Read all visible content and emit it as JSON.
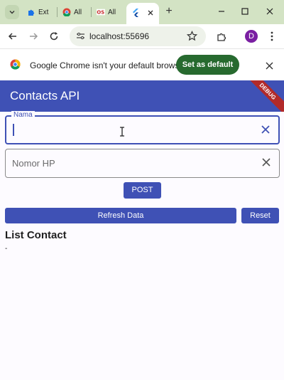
{
  "browser": {
    "tabs": [
      {
        "label": "Ext",
        "icon": "puzzle-icon"
      },
      {
        "label": "All",
        "icon": "chrome-icon"
      },
      {
        "label": "All",
        "icon": "ots-icon"
      },
      {
        "label": "",
        "icon": "flutter-icon"
      }
    ],
    "new_tab_label": "+",
    "url": "localhost:55696",
    "avatar_letter": "D",
    "infobar_message": "Google Chrome isn't your default browser",
    "set_default_label": "Set as default"
  },
  "app": {
    "title": "Contacts API",
    "debug_banner": "DEBUG",
    "accent_color": "#3f51b5"
  },
  "form": {
    "nama_label": "Nama",
    "nama_value": "",
    "nomor_placeholder": "Nomor HP",
    "post_label": "POST"
  },
  "actions": {
    "refresh_label": "Refresh Data",
    "reset_label": "Reset"
  },
  "list": {
    "title": "List Contact",
    "empty_text": "-"
  }
}
